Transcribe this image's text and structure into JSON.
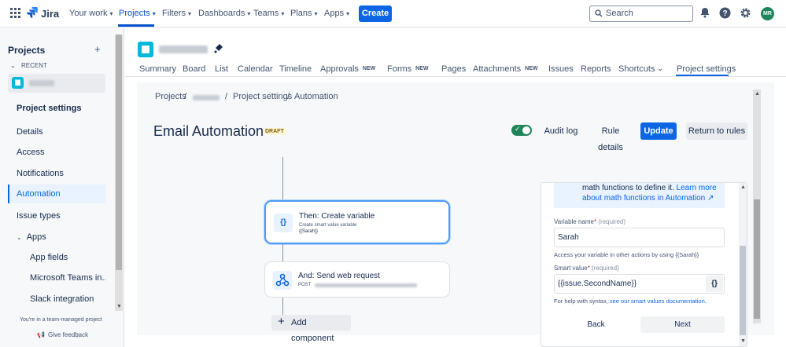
{
  "topnav": {
    "product": "Jira",
    "items": [
      {
        "label": "Your work"
      },
      {
        "label": "Projects"
      },
      {
        "label": "Filters"
      },
      {
        "label": "Dashboards"
      },
      {
        "label": "Teams"
      },
      {
        "label": "Plans"
      },
      {
        "label": "Apps"
      }
    ],
    "create_label": "Create",
    "search_placeholder": "Search",
    "avatar_initials": "MR",
    "icons": [
      "app-switcher-icon",
      "notifications-icon",
      "help-icon",
      "settings-icon"
    ]
  },
  "sidebar": {
    "title": "Projects",
    "recent_label": "RECENT",
    "section_label": "Project settings",
    "items": [
      {
        "label": "Details"
      },
      {
        "label": "Access"
      },
      {
        "label": "Notifications"
      },
      {
        "label": "Automation"
      },
      {
        "label": "Issue types"
      },
      {
        "label": "Apps"
      },
      {
        "label": "App fields"
      },
      {
        "label": "Microsoft Teams in..."
      },
      {
        "label": "Slack integration"
      }
    ],
    "footer_note": "You're in a team-managed project",
    "feedback_label": "Give feedback"
  },
  "tabs": [
    {
      "label": "Summary"
    },
    {
      "label": "Board"
    },
    {
      "label": "List"
    },
    {
      "label": "Calendar"
    },
    {
      "label": "Timeline"
    },
    {
      "label": "Approvals",
      "badge": "NEW"
    },
    {
      "label": "Forms",
      "badge": "NEW"
    },
    {
      "label": "Pages"
    },
    {
      "label": "Attachments",
      "badge": "NEW"
    },
    {
      "label": "Issues"
    },
    {
      "label": "Reports"
    },
    {
      "label": "Shortcuts"
    },
    {
      "label": "Project settings"
    }
  ],
  "breadcrumb": {
    "root": "Projects",
    "sep": "/",
    "settings": "Project settings",
    "current": "Automation"
  },
  "rule": {
    "title": "Email Automation",
    "status_badge": "DRAFT",
    "audit_log": "Audit log",
    "rule_details": "Rule details",
    "update": "Update",
    "return": "Return to rules"
  },
  "flow": {
    "card1": {
      "title": "Then: Create variable",
      "subtitle": "Create smart value variable",
      "value": "{{Sarah}}"
    },
    "card2": {
      "title": "And: Send web request",
      "subtitle": "POST"
    },
    "add_component": "Add component"
  },
  "panel": {
    "info_text": "math functions to define it.",
    "info_link": "Learn more about math functions in Automation ↗",
    "variable_name_label": "Variable name",
    "required": "(required)",
    "variable_name_value": "Sarah",
    "variable_help": "Access your variable in other actions by using {{Sarah}}",
    "smart_value_label": "Smart value",
    "smart_value_value": "{{issue.SecondName}}",
    "smart_value_help": "For help with syntax,",
    "smart_value_link": "see our smart values documentation.",
    "back_label": "Back",
    "next_label": "Next"
  },
  "colors": {
    "brand_blue": "#0c66e4",
    "toggle_green": "#1f845a",
    "selection_blue": "#4c9aff"
  }
}
